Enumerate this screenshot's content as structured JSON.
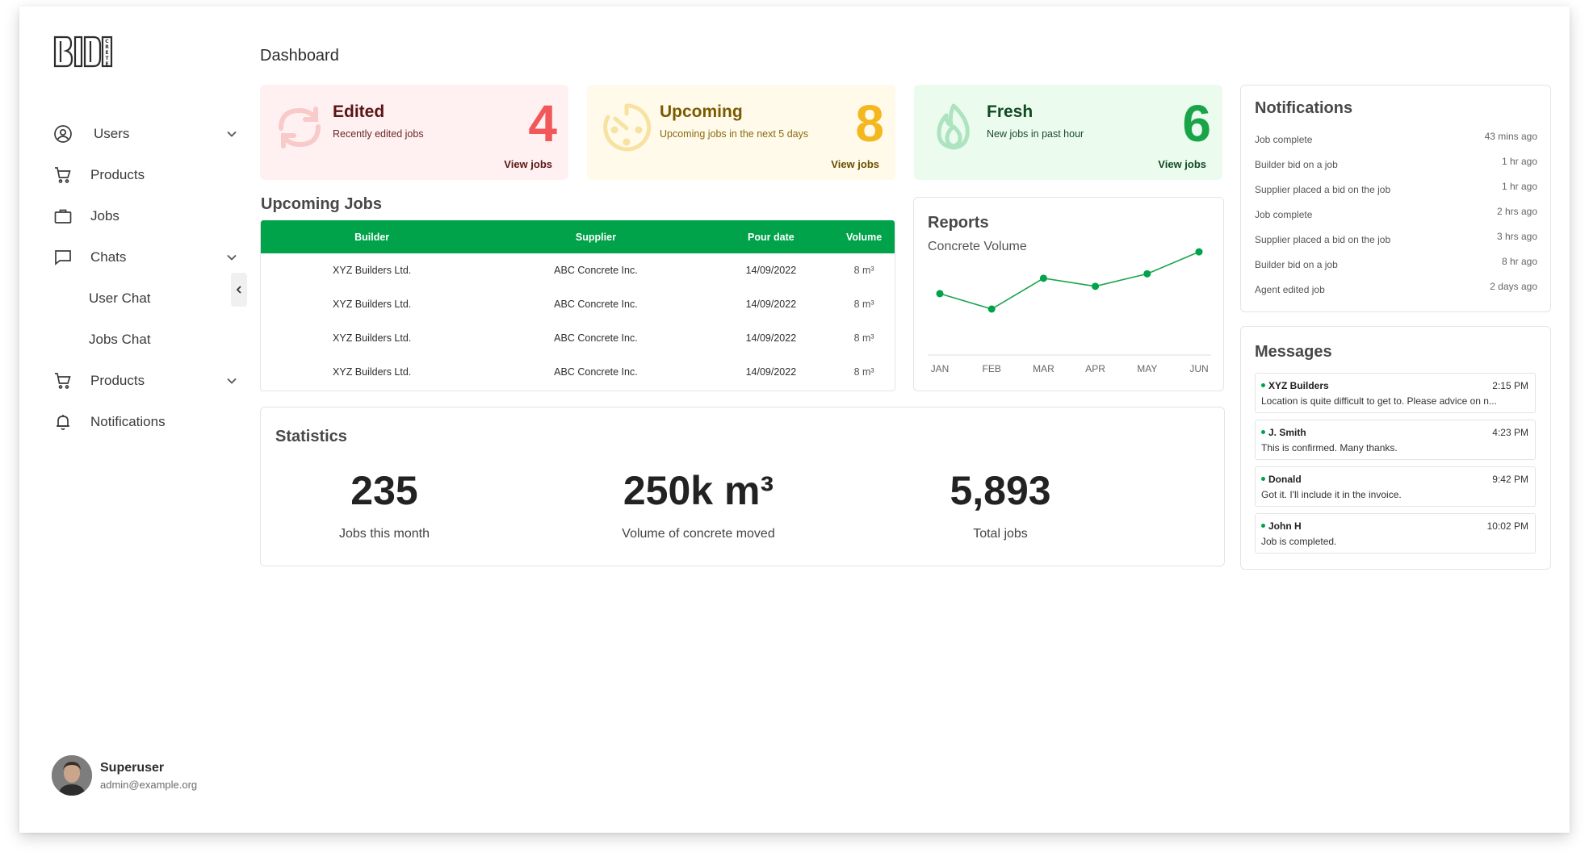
{
  "app": {
    "logo_text": "BIDCRETE"
  },
  "sidebar": {
    "items": [
      {
        "label": "Users",
        "icon": "user-circle-icon",
        "has_chevron": true
      },
      {
        "label": "Products",
        "icon": "cart-icon",
        "has_chevron": false
      },
      {
        "label": "Jobs",
        "icon": "briefcase-icon",
        "has_chevron": false
      },
      {
        "label": "Chats",
        "icon": "chat-icon",
        "has_chevron": true
      },
      {
        "label": "User Chat",
        "sub": true
      },
      {
        "label": "Jobs Chat",
        "sub": true
      },
      {
        "label": "Products",
        "icon": "cart-icon",
        "has_chevron": true
      },
      {
        "label": "Notifications",
        "icon": "bell-icon",
        "has_chevron": false
      }
    ],
    "user": {
      "name": "Superuser",
      "email": "admin@example.org"
    }
  },
  "header": {
    "title": "Dashboard"
  },
  "summary_cards": {
    "edited": {
      "title": "Edited",
      "subtitle": "Recently edited jobs",
      "count": "4",
      "link": "View jobs",
      "color": "#f2575a"
    },
    "upcoming": {
      "title": "Upcoming",
      "subtitle": "Upcoming jobs in the next 5 days",
      "count": "8",
      "link": "View jobs",
      "color": "#f4b71f"
    },
    "fresh": {
      "title": "Fresh",
      "subtitle": "New jobs in past hour",
      "count": "6",
      "link": "View jobs",
      "color": "#1aa44a"
    }
  },
  "upcoming_jobs": {
    "title": "Upcoming Jobs",
    "columns": [
      "Builder",
      "Supplier",
      "Pour date",
      "Volume"
    ],
    "rows": [
      [
        "XYZ Builders Ltd.",
        "ABC Concrete Inc.",
        "14/09/2022",
        "8 m³"
      ],
      [
        "XYZ Builders Ltd.",
        "ABC Concrete Inc.",
        "14/09/2022",
        "8 m³"
      ],
      [
        "XYZ Builders Ltd.",
        "ABC Concrete Inc.",
        "14/09/2022",
        "8 m³"
      ],
      [
        "XYZ Builders Ltd.",
        "ABC Concrete Inc.",
        "14/09/2022",
        "8 m³"
      ]
    ],
    "header_color": "#00a24a"
  },
  "reports": {
    "title": "Reports",
    "subtitle": "Concrete Volume"
  },
  "chart_data": {
    "type": "line",
    "title": "Concrete Volume",
    "categories": [
      "JAN",
      "FEB",
      "MAR",
      "APR",
      "MAY",
      "JUN"
    ],
    "series": [
      {
        "values": [
          43,
          22,
          64,
          53,
          70,
          100
        ]
      }
    ],
    "ylim": [
      0,
      110
    ],
    "grid": false,
    "color": "#1aa44a"
  },
  "statistics": {
    "title": "Statistics",
    "items": [
      {
        "value": "235",
        "label": "Jobs this month"
      },
      {
        "value": "250k m³",
        "label": "Volume of concrete moved"
      },
      {
        "value": "5,893",
        "label": "Total jobs"
      }
    ]
  },
  "notifications": {
    "title": "Notifications",
    "items": [
      {
        "text": "Job complete",
        "when": "43 mins ago"
      },
      {
        "text": "Builder bid on a job",
        "when": "1 hr ago"
      },
      {
        "text": "Supplier placed a bid on the job",
        "when": "1 hr ago"
      },
      {
        "text": "Job complete",
        "when": "2 hrs ago"
      },
      {
        "text": "Supplier placed a bid on the job",
        "when": "3 hrs ago"
      },
      {
        "text": "Builder bid on a job",
        "when": "8 hr ago"
      },
      {
        "text": "Agent edited job",
        "when": "2 days ago"
      }
    ]
  },
  "messages": {
    "title": "Messages",
    "items": [
      {
        "from": "XYZ Builders",
        "time": "2:15 PM",
        "body": "Location is quite difficult to get to. Please advice on n..."
      },
      {
        "from": "J. Smith",
        "time": "4:23 PM",
        "body": "This is confirmed. Many thanks."
      },
      {
        "from": "Donald",
        "time": "9:42 PM",
        "body": "Got it. I'll include it in the invoice."
      },
      {
        "from": "John H",
        "time": "10:02 PM",
        "body": "Job is completed."
      }
    ]
  }
}
